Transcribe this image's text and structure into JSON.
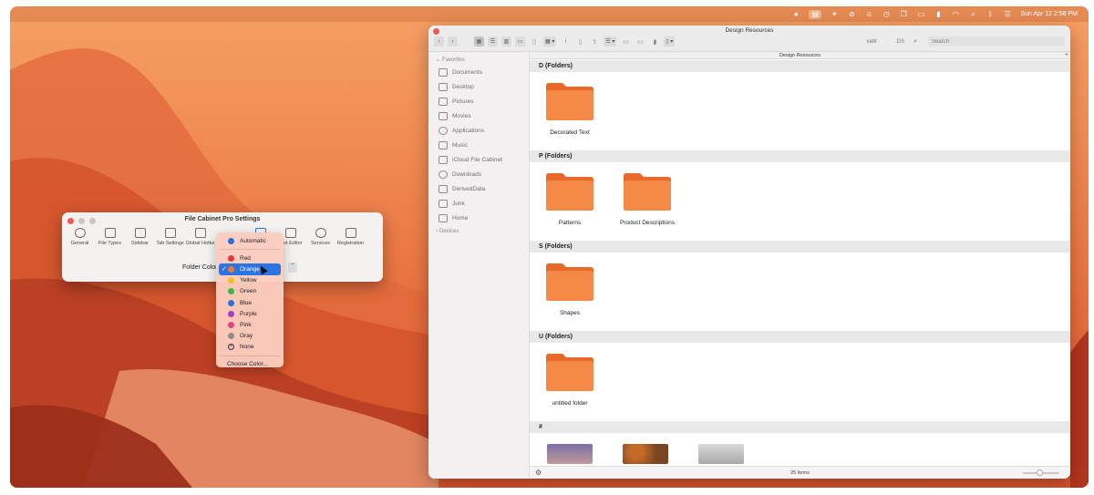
{
  "menubar": {
    "clock": "Sun Apr 12  2:58 PM",
    "icons": [
      "record-icon",
      "file-cabinet-icon",
      "ai-icon",
      "check-circle-icon",
      "lock-icon",
      "clock-icon",
      "window-icon",
      "card-icon",
      "battery-icon",
      "wifi-icon",
      "search-icon",
      "bluetooth-icon",
      "control-center-icon"
    ]
  },
  "settings": {
    "title": "File Cabinet Pro Settings",
    "toolbar": [
      "General",
      "File Types",
      "Sidebar",
      "Tab Settings",
      "Global Hotke",
      "",
      "",
      "Text Editor",
      "Services",
      "Registration"
    ],
    "folder_color_label": "Folder Color"
  },
  "color_menu": {
    "automatic": "Automatic",
    "items": [
      {
        "label": "Red",
        "color": "#e5383b"
      },
      {
        "label": "Orange",
        "color": "#f07a2f",
        "selected": true
      },
      {
        "label": "Yellow",
        "color": "#f4bf2a"
      },
      {
        "label": "Green",
        "color": "#3fb44c"
      },
      {
        "label": "Blue",
        "color": "#2f6fd8"
      },
      {
        "label": "Purple",
        "color": "#a041c2"
      },
      {
        "label": "Pink",
        "color": "#e2457a"
      },
      {
        "label": "Gray",
        "color": "#8c8c8c"
      }
    ],
    "none": "None",
    "choose": "Choose Color..."
  },
  "finder": {
    "title": "Design Resources",
    "path": "Design Resources",
    "xattr": "xattr",
    "ds": ".DS",
    "search_placeholder": "Search",
    "sidebar": {
      "favorites": "Favorites",
      "items": [
        "Documents",
        "Desktop",
        "Pictures",
        "Movies",
        "Applications",
        "Music",
        "iCloud File Cabinet",
        "Downloads",
        "DerivedData",
        "Junk",
        "Home"
      ],
      "devices": "Devices"
    },
    "sections": [
      {
        "header": "D (Folders)",
        "folders": [
          "Decorated Text"
        ]
      },
      {
        "header": "P (Folders)",
        "folders": [
          "Patterns",
          "Product Descriptions"
        ]
      },
      {
        "header": "S (Folders)",
        "folders": [
          "Shapes"
        ]
      },
      {
        "header": "U (Folders)",
        "folders": [
          "untitled folder"
        ]
      }
    ],
    "hash_header": "#",
    "status": "25 items"
  }
}
